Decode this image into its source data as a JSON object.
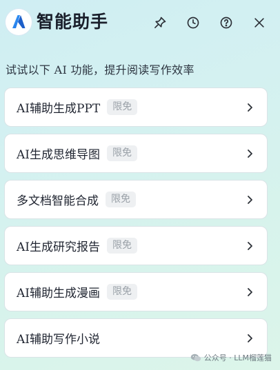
{
  "app": {
    "title": "智能助手",
    "logo_icon": "app-logo-icon",
    "accent_color": "#2f8cf5"
  },
  "header_actions": [
    {
      "name": "pin",
      "icon": "pin-icon"
    },
    {
      "name": "history",
      "icon": "clock-icon"
    },
    {
      "name": "help",
      "icon": "help-circle-icon"
    },
    {
      "name": "close",
      "icon": "close-icon"
    }
  ],
  "subtitle": "试试以下 AI 功能，提升阅读写作效率",
  "features": [
    {
      "label": "AI辅助生成PPT",
      "badge": "限免"
    },
    {
      "label": "AI生成思维导图",
      "badge": "限免"
    },
    {
      "label": "多文档智能合成",
      "badge": "限免"
    },
    {
      "label": "AI生成研究报告",
      "badge": "限免"
    },
    {
      "label": "AI辅助生成漫画",
      "badge": "限免"
    },
    {
      "label": "AI辅助写作小说",
      "badge": ""
    }
  ],
  "watermark": {
    "text": "公众号 · LLM榴莲猫",
    "icon": "wechat-icon"
  }
}
